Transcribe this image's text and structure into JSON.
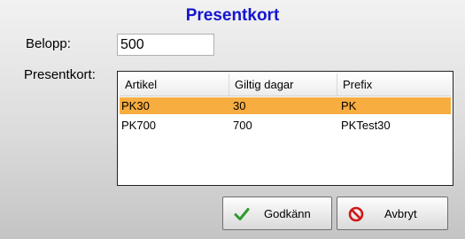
{
  "dialog": {
    "title": "Presentkort"
  },
  "amount": {
    "label": "Belopp:",
    "value": "500"
  },
  "list": {
    "label": "Presentkort:",
    "columns": [
      "Artikel",
      "Giltig dagar",
      "Prefix"
    ],
    "rows": [
      {
        "artikel": "PK30",
        "giltig": "30",
        "prefix": "PK",
        "selected": true
      },
      {
        "artikel": "PK700",
        "giltig": "700",
        "prefix": "PKTest30",
        "selected": false
      }
    ]
  },
  "buttons": {
    "ok_label": "Godkänn",
    "ok_icon": "checkmark-icon",
    "cancel_label": "Avbryt",
    "cancel_icon": "cancel-icon"
  },
  "colors": {
    "title": "#1414d0",
    "selection": "#f7ad3f",
    "ok_icon": "#2e9a2e",
    "cancel_icon": "#d01818"
  }
}
